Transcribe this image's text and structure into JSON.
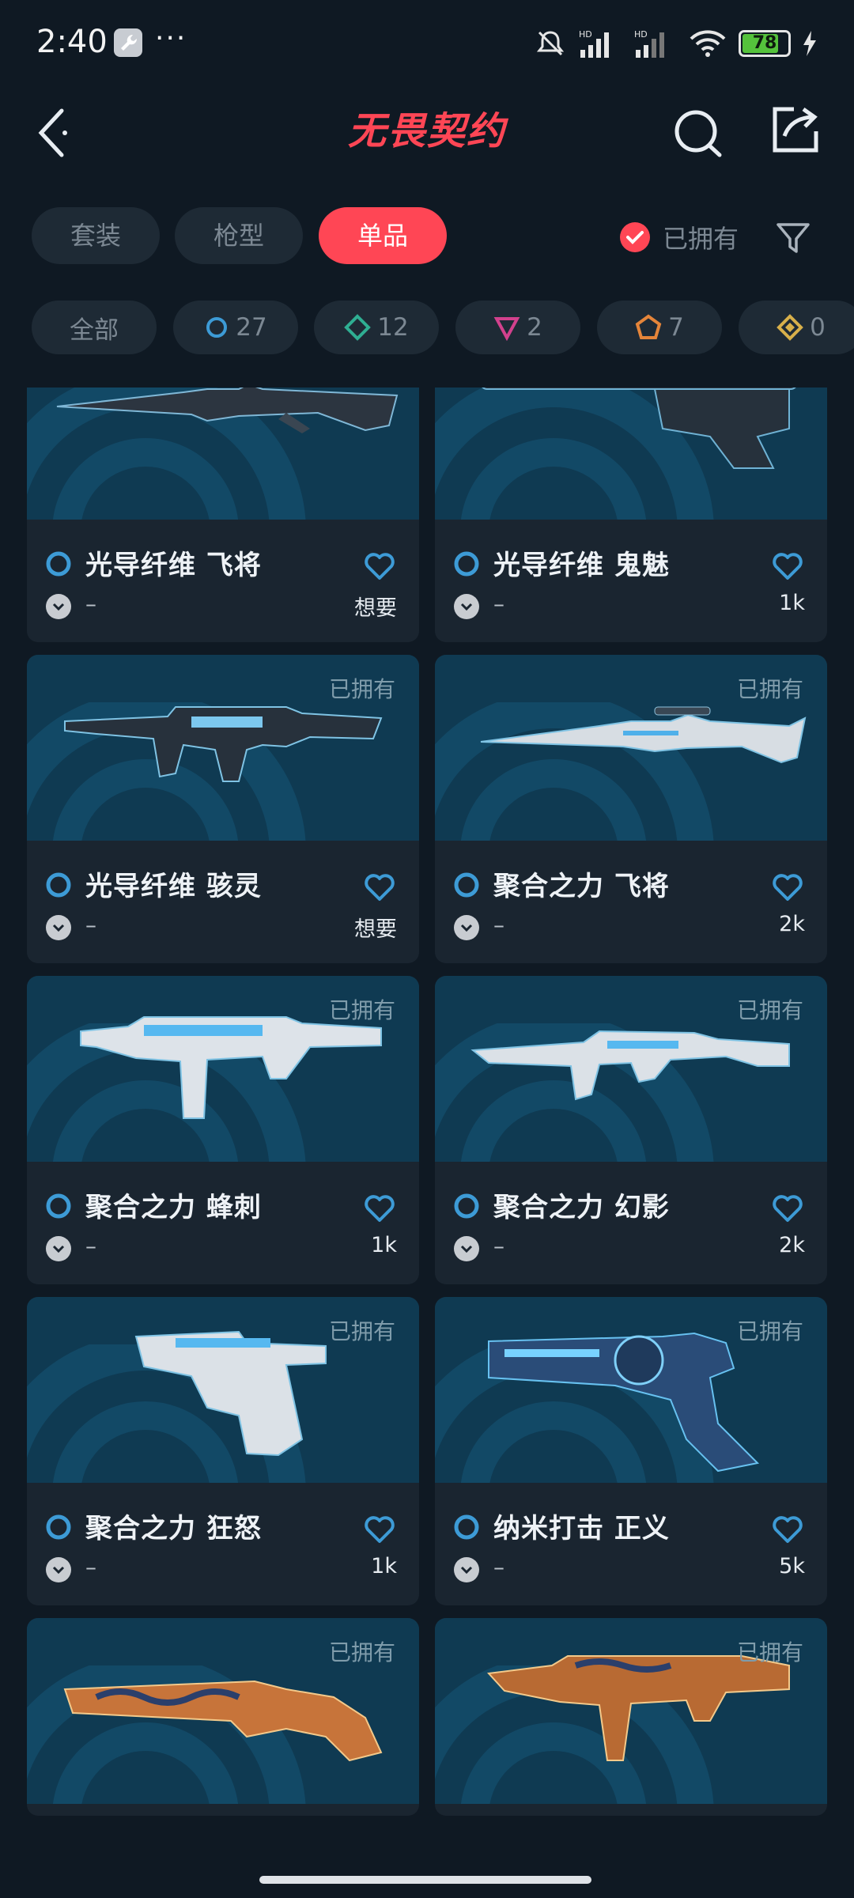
{
  "status": {
    "time": "2:40",
    "dots": "···",
    "battery": "78",
    "battery_level": 0.78,
    "network_labels": [
      "HD",
      "HD"
    ]
  },
  "header": {
    "logo": "无畏契约"
  },
  "tabs": [
    {
      "label": "套装",
      "active": false
    },
    {
      "label": "枪型",
      "active": false
    },
    {
      "label": "单品",
      "active": true
    }
  ],
  "owned_filter": {
    "label": "已拥有",
    "checked": true
  },
  "chips": [
    {
      "label": "全部",
      "count": ""
    },
    {
      "label": "",
      "count": "27",
      "icon": "blue-ring-icon",
      "color": "#3d9bd6"
    },
    {
      "label": "",
      "count": "12",
      "icon": "green-diamond-icon",
      "color": "#2fae92"
    },
    {
      "label": "",
      "count": "2",
      "icon": "pink-triangle-icon",
      "color": "#d2418d"
    },
    {
      "label": "",
      "count": "7",
      "icon": "orange-pentagon-icon",
      "color": "#e5853a"
    },
    {
      "label": "",
      "count": "0",
      "icon": "yellow-diamond-icon",
      "color": "#d8b04a"
    }
  ],
  "cards": [
    {
      "name": "光导纤维 飞将",
      "owned_label": "",
      "sub": "–",
      "right": "想要",
      "gun": "sniper-dark"
    },
    {
      "name": "光导纤维 鬼魅",
      "owned_label": "",
      "sub": "–",
      "right": "1k",
      "gun": "pistol-dark"
    },
    {
      "name": "光导纤维 骇灵",
      "owned_label": "已拥有",
      "sub": "–",
      "right": "想要",
      "gun": "smg-dark"
    },
    {
      "name": "聚合之力 飞将",
      "owned_label": "已拥有",
      "sub": "–",
      "right": "2k",
      "gun": "sniper-white"
    },
    {
      "name": "聚合之力 蜂刺",
      "owned_label": "已拥有",
      "sub": "–",
      "right": "1k",
      "gun": "smg-white"
    },
    {
      "name": "聚合之力 幻影",
      "owned_label": "已拥有",
      "sub": "–",
      "right": "2k",
      "gun": "rifle-white"
    },
    {
      "name": "聚合之力 狂怒",
      "owned_label": "已拥有",
      "sub": "–",
      "right": "1k",
      "gun": "frenzy-white"
    },
    {
      "name": "纳米打击 正义",
      "owned_label": "已拥有",
      "sub": "–",
      "right": "5k",
      "gun": "revolver-blue"
    },
    {
      "name": "",
      "owned_label": "已拥有",
      "sub": "",
      "right": "",
      "gun": "shotgun-gold"
    },
    {
      "name": "",
      "owned_label": "已拥有",
      "sub": "",
      "right": "",
      "gun": "smg-gold"
    }
  ],
  "colors": {
    "accent": "#ff4655",
    "background": "#0f1923",
    "card": "#1a2530",
    "card_image_bg": "#0f3a52",
    "heart": "#3d9bd6",
    "tier_blue": "#3d9bd6"
  }
}
